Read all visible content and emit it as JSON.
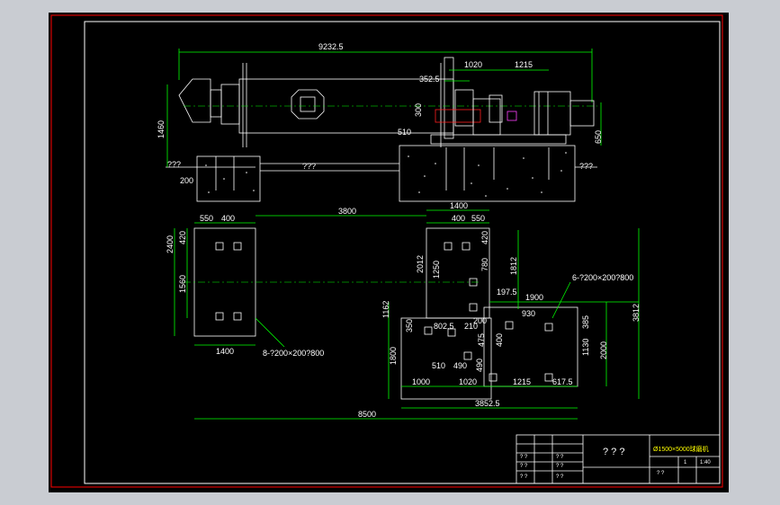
{
  "window": {
    "background": "#c9ccd2",
    "canvas": "#000000"
  },
  "colors": {
    "line": "#ffffff",
    "dimension": "#00ff00",
    "accent": "#ff2020",
    "yellow": "#ffff00",
    "frame": "#ff0000"
  },
  "elevation": {
    "overall_length": "9232.5",
    "d1020": "1020",
    "d1215": "1215",
    "d352_5": "352.5",
    "d1460": "1460",
    "d300": "300",
    "d510": "510",
    "d650": "650",
    "d200": "200",
    "q_left": "???",
    "q_mid": "???",
    "q_right": "???"
  },
  "plan": {
    "d550a": "550",
    "d400a": "400",
    "d3800": "3800",
    "d1400a": "1400",
    "d400b": "400",
    "d550b": "550",
    "d2400": "2400",
    "d420a": "420",
    "d1560": "1560",
    "d1400b": "1400",
    "bolt_left": "8-?200×200?800",
    "d2012": "2012",
    "d420b": "420",
    "d780": "780",
    "d1250": "1250",
    "d1812": "1812",
    "d197_5": "197.5",
    "d1900": "1900",
    "bolt_right": "6-?200×200?800",
    "d1162": "1162",
    "d930": "930",
    "d385": "385",
    "d3812": "3812",
    "d350": "350",
    "d802_5": "802.5",
    "d210": "210",
    "d200": "200",
    "d475": "475",
    "d400c": "400",
    "d1130": "1130",
    "d2000": "2000",
    "d1800": "1800",
    "d510": "510",
    "d490": "490",
    "d490b": "490",
    "d1000": "1000",
    "d1020": "1020",
    "d1215": "1215",
    "d617_5": "617.5",
    "d8500": "8500",
    "d3852_5": "3852.5"
  },
  "title_block": {
    "heading": "? ? ?",
    "drawing_name": "Ø1500×5000球磨机",
    "scale": "1:40",
    "cell_q": "? ?",
    "sheet": "1",
    "cells": [
      "? ?",
      "? ?",
      "? ?",
      "? ?",
      "? ?",
      "? ?"
    ]
  }
}
